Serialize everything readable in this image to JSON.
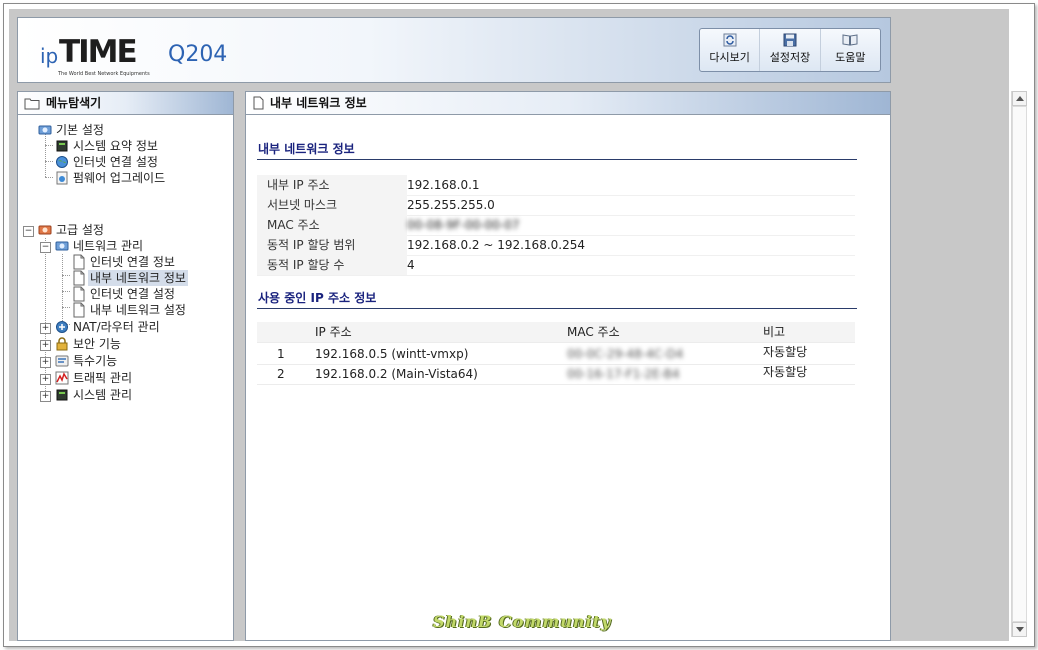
{
  "header": {
    "logo_ip": "ip",
    "logo_time": "TIME",
    "logo_model": "Q204",
    "logo_tagline": "The World Best Network Equipments",
    "toolbar": {
      "refresh_label": "다시보기",
      "save_label": "설정저장",
      "help_label": "도움말"
    }
  },
  "sidebar": {
    "title": "메뉴탐색기",
    "basic": {
      "label": "기본 설정",
      "items": [
        "시스템 요약 정보",
        "인터넷 연결 설정",
        "펌웨어 업그레이드"
      ]
    },
    "advanced": {
      "label": "고급 설정",
      "network": {
        "label": "네트워크 관리",
        "items": [
          "인터넷 연결 정보",
          "내부 네트워크 정보",
          "인터넷 연결 설정",
          "내부 네트워크 설정"
        ],
        "selected_index": 1
      },
      "groups": [
        "NAT/라우터 관리",
        "보안 기능",
        "특수기능",
        "트래픽 관리",
        "시스템 관리"
      ]
    }
  },
  "content": {
    "title": "내부 네트워크 정보",
    "internal": {
      "section_title": "내부 네트워크 정보",
      "rows": [
        {
          "key": "내부 IP 주소",
          "value": "192.168.0.1"
        },
        {
          "key": "서브넷 마스크",
          "value": "255.255.255.0"
        },
        {
          "key": "MAC 주소",
          "value": "00-08-9F-00-00-07"
        },
        {
          "key": "동적 IP 할당 범위",
          "value": "192.168.0.2 ~  192.168.0.254"
        },
        {
          "key": "동적 IP 할당 수",
          "value": "4"
        }
      ]
    },
    "used_ip": {
      "section_title": "사용 중인 IP 주소 정보",
      "columns": [
        "IP 주소",
        "MAC 주소",
        "비고"
      ],
      "rows": [
        {
          "no": "1",
          "ip": "192.168.0.5 (wintt-vmxp)",
          "mac": "00-0C-29-48-4C-D4",
          "note": "자동할당"
        },
        {
          "no": "2",
          "ip": "192.168.0.2 (Main-Vista64)",
          "mac": "00-16-17-F1-2E-B4",
          "note": "자동할당"
        }
      ]
    }
  },
  "watermark": "ShinB Community"
}
